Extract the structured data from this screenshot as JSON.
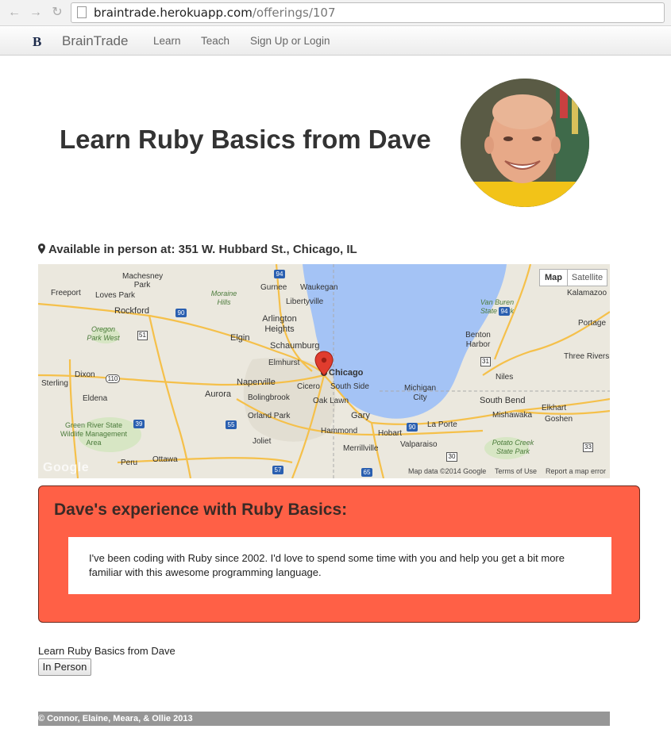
{
  "browser": {
    "url_host": "braintrade.herokuapp.com",
    "url_path": "/offerings/107",
    "back_icon": "arrow-left-icon",
    "forward_icon": "arrow-right-icon",
    "reload_icon": "reload-icon"
  },
  "navbar": {
    "brand": "BrainTrade",
    "links": [
      "Learn",
      "Teach",
      "Sign Up or Login"
    ]
  },
  "offering": {
    "title": "Learn Ruby Basics from Dave",
    "location": "Available in person at: 351 W. Hubbard St., Chicago, IL"
  },
  "map": {
    "type_buttons": [
      "Map",
      "Satellite"
    ],
    "attribution": [
      "Map data ©2014 Google",
      "Terms of Use",
      "Report a map error"
    ],
    "google": "Google",
    "cities": [
      {
        "name": "Machesney Park"
      },
      {
        "name": "Freeport"
      },
      {
        "name": "Loves Park"
      },
      {
        "name": "Rockford"
      },
      {
        "name": "Oregon Park West"
      },
      {
        "name": "Moraine Hills"
      },
      {
        "name": "Gurnee"
      },
      {
        "name": "Waukegan"
      },
      {
        "name": "Libertyville"
      },
      {
        "name": "Arlington Heights"
      },
      {
        "name": "Elgin"
      },
      {
        "name": "Schaumburg"
      },
      {
        "name": "Elmhurst"
      },
      {
        "name": "Chicago"
      },
      {
        "name": "Cicero"
      },
      {
        "name": "South Side"
      },
      {
        "name": "Dixon"
      },
      {
        "name": "Sterling"
      },
      {
        "name": "Eldena"
      },
      {
        "name": "Aurora"
      },
      {
        "name": "Naperville"
      },
      {
        "name": "Bolingbrook"
      },
      {
        "name": "Oak Lawn"
      },
      {
        "name": "Orland Park"
      },
      {
        "name": "Gary"
      },
      {
        "name": "Hammond"
      },
      {
        "name": "Hobart"
      },
      {
        "name": "Michigan City"
      },
      {
        "name": "La Porte"
      },
      {
        "name": "Valparaiso"
      },
      {
        "name": "Merrillville"
      },
      {
        "name": "Joliet"
      },
      {
        "name": "Green River State Wildlife Management Area"
      },
      {
        "name": "Peru"
      },
      {
        "name": "Ottawa"
      },
      {
        "name": "Van Buren State Park"
      },
      {
        "name": "Kalamazoo"
      },
      {
        "name": "Portage"
      },
      {
        "name": "Benton Harbor"
      },
      {
        "name": "Three Rivers"
      },
      {
        "name": "Niles"
      },
      {
        "name": "South Bend"
      },
      {
        "name": "Elkhart"
      },
      {
        "name": "Mishawaka"
      },
      {
        "name": "Goshen"
      },
      {
        "name": "Potato Creek State Park"
      }
    ],
    "shields": [
      "94",
      "90",
      "51",
      "110",
      "39",
      "55",
      "57",
      "65",
      "30",
      "90",
      "94",
      "31",
      "33"
    ]
  },
  "experience": {
    "heading": "Dave's experience with Ruby Basics:",
    "body": "I've been coding with Ruby since 2002. I'd love to spend some time with you and help you get a bit more familiar with this awesome programming language."
  },
  "form": {
    "label": "Learn Ruby Basics from Dave",
    "button": "In Person"
  },
  "footer": {
    "text": "© Connor, Elaine, Meara, & Ollie 2013"
  },
  "colors": {
    "experience_bg": "#ff6046",
    "lake": "#a4c3f5",
    "highway": "#f5c04a",
    "pin": "#e03c2e"
  }
}
